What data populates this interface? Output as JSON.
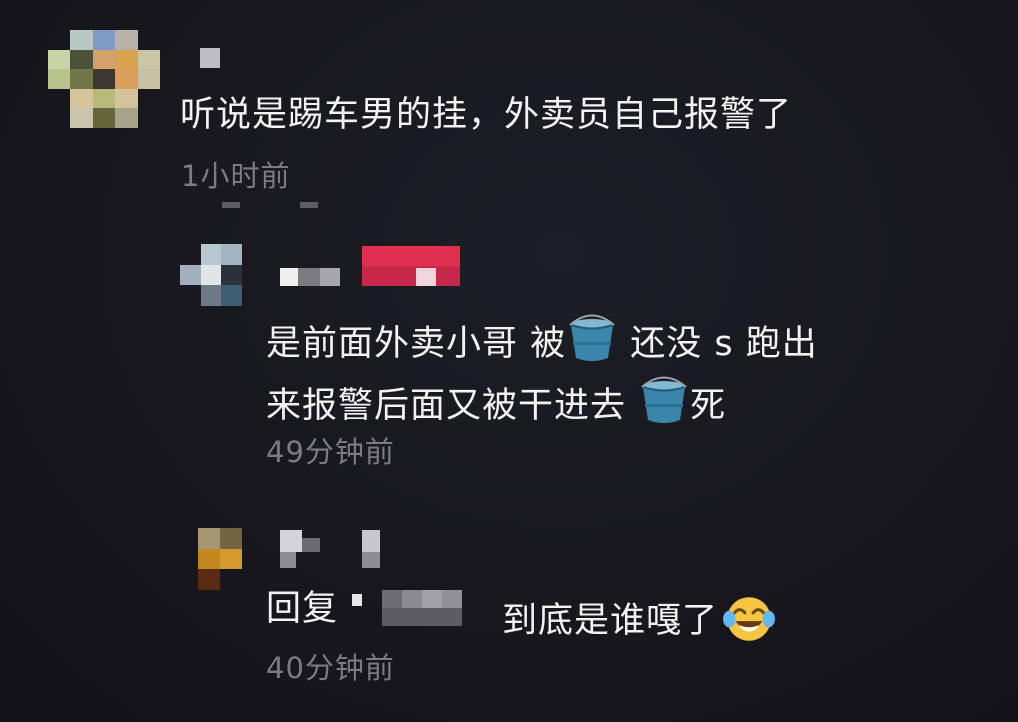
{
  "comments": [
    {
      "text": "听说是踢车男的挂，外卖员自己报警了",
      "time": "1小时前"
    },
    {
      "line1_a": "是前面外卖小哥  被",
      "line1_b": " 还没 s  跑出",
      "line2_a": "来报警后面又被干进去 ",
      "line2_b": "死",
      "time": "49分钟前"
    },
    {
      "reply_prefix": "回复",
      "text": "到底是谁嘎了",
      "time": "40分钟前"
    }
  ],
  "icons": {
    "bucket": "bucket-icon",
    "laugh": "tears-of-joy-emoji"
  },
  "colors": {
    "background": "#17171d",
    "text": "#f3f3f3",
    "timestamp": "#7b7b80",
    "redacted_pink": "#e0304f"
  }
}
